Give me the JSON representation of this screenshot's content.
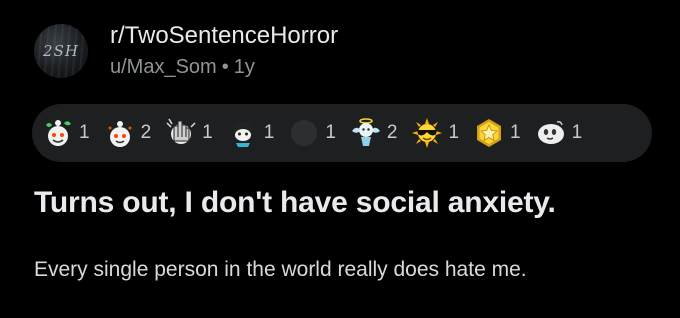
{
  "post": {
    "subreddit": "r/TwoSentenceHorror",
    "avatar_text": "2SH",
    "author": "u/Max_Som",
    "separator": "•",
    "age": "1y",
    "title": "Turns out, I don't have social anxiety.",
    "body": "Every single person in the world really does hate me."
  },
  "awards": [
    {
      "icon": "wholesome-award-icon",
      "count": "1"
    },
    {
      "icon": "helpful-award-icon",
      "count": "2"
    },
    {
      "icon": "facepalm-award-icon",
      "count": "1"
    },
    {
      "icon": "cat-snoo-award-icon",
      "count": "1"
    },
    {
      "icon": "blank-award-icon",
      "count": "1"
    },
    {
      "icon": "angel-award-icon",
      "count": "2"
    },
    {
      "icon": "sunglasses-award-icon",
      "count": "1"
    },
    {
      "icon": "gold-star-award-icon",
      "count": "1"
    },
    {
      "icon": "ghost-award-icon",
      "count": "1"
    }
  ],
  "colors": {
    "background": "#000000",
    "award_bar": "#1d1f21",
    "text_primary": "#e8eaed",
    "text_secondary": "#8f9497"
  }
}
